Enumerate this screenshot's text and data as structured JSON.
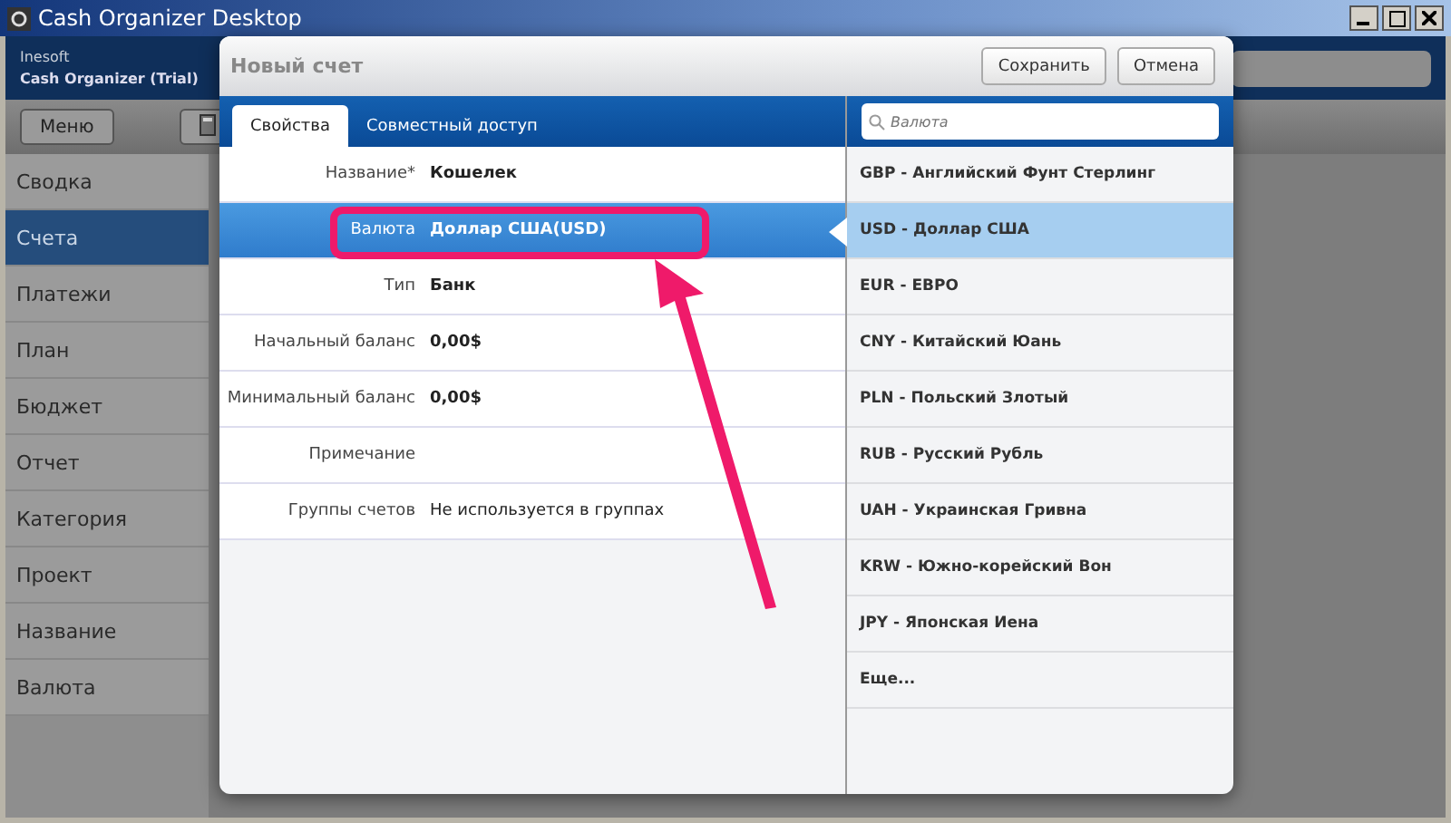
{
  "window": {
    "title": "Cash Organizer Desktop"
  },
  "header": {
    "company": "Inesoft",
    "product": "Cash Organizer (Trial)"
  },
  "toolbar": {
    "menu_button": "Меню"
  },
  "sidebar": {
    "items": [
      {
        "label": "Сводка",
        "selected": false
      },
      {
        "label": "Счета",
        "selected": true
      },
      {
        "label": "Платежи",
        "selected": false
      },
      {
        "label": "План",
        "selected": false
      },
      {
        "label": "Бюджет",
        "selected": false
      },
      {
        "label": "Отчет",
        "selected": false
      },
      {
        "label": "Категория",
        "selected": false
      },
      {
        "label": "Проект",
        "selected": false
      },
      {
        "label": "Название",
        "selected": false
      },
      {
        "label": "Валюта",
        "selected": false
      }
    ]
  },
  "dialog": {
    "title": "Новый счет",
    "buttons": [
      "Сохранить",
      "Отмена"
    ],
    "tabs": [
      {
        "label": "Свойства",
        "selected": true
      },
      {
        "label": "Совместный доступ",
        "selected": false
      }
    ],
    "fields": [
      {
        "label": "Название*",
        "value": "Кошелек",
        "selected": false,
        "bold": true
      },
      {
        "label": "Валюта",
        "value": "Доллар США(USD)",
        "selected": true,
        "bold": true
      },
      {
        "label": "Тип",
        "value": "Банк",
        "selected": false,
        "bold": true
      },
      {
        "label": "Начальный баланс",
        "value": "0,00$",
        "selected": false,
        "bold": true
      },
      {
        "label": "Минимальный баланс",
        "value": "0,00$",
        "selected": false,
        "bold": true
      },
      {
        "label": "Примечание",
        "selected": false
      },
      {
        "label": "Группы счетов",
        "value": "Не используется в группах",
        "selected": false,
        "bold": false
      }
    ],
    "search": {
      "placeholder": "Валюта"
    },
    "currencies": [
      {
        "label": "GBP - Английский Фунт Стерлинг",
        "selected": false
      },
      {
        "label": "USD - Доллар США",
        "selected": true
      },
      {
        "label": "EUR - ЕВРО",
        "selected": false
      },
      {
        "label": "CNY - Китайский Юань",
        "selected": false
      },
      {
        "label": "PLN - Польский Злотый",
        "selected": false
      },
      {
        "label": "RUB - Русский Рубль",
        "selected": false
      },
      {
        "label": "UAH - Украинская Гривна",
        "selected": false
      },
      {
        "label": "KRW - Южно-корейский Вон",
        "selected": false
      },
      {
        "label": "JPY - Японская Иена",
        "selected": false
      },
      {
        "label": "Еще...",
        "selected": false
      }
    ]
  }
}
